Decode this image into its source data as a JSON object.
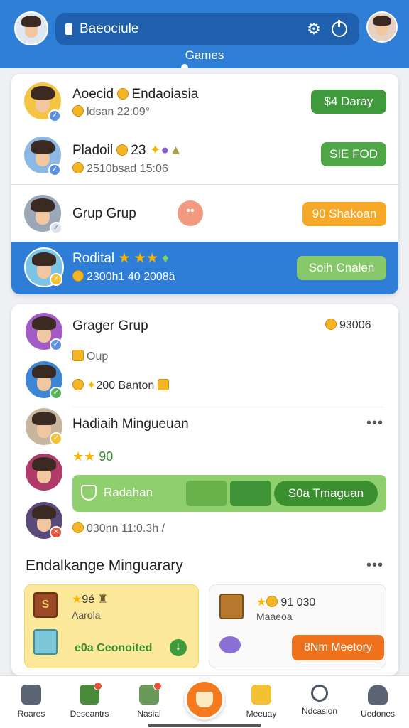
{
  "header": {
    "search_text": "Baeociule",
    "tab_label": "Games"
  },
  "card1": {
    "rows": [
      {
        "name": "Aoecid",
        "name_extra": "Endaoiasia",
        "sub": "ldsan 22:09°",
        "button": "$4 Daray"
      },
      {
        "name": "Pladoil",
        "name_extra": "23",
        "sub": "2510bsad 15:06",
        "button": "SIE FOD"
      },
      {
        "name": "Grup Grup",
        "button": "90 Shakoan",
        "peach": "••"
      },
      {
        "name": "Rodital",
        "sub": "2300h1 40 2008ä",
        "button": "Soih Cnalen"
      }
    ]
  },
  "card2": {
    "group_title": "Grager Grup",
    "group_coins": "93006",
    "row_oup": "Oup",
    "row_batton": "200 Banton",
    "hadiah_title": "Hadiaih Mingueuan",
    "dots": "•••",
    "score": "90",
    "progress_label": "Radahan",
    "progress_button": "S0a Tmaguan",
    "footer_text": "030nn 11:0.3h /",
    "section_title": "Endalkange Minguarary",
    "tile_left": {
      "line1": "9é",
      "line2": "Aarola",
      "line3": "e0a Ceonoited"
    },
    "tile_right": {
      "line1": "91  030",
      "line2": "Maaeoa",
      "cta": "8Nm Meetory"
    }
  },
  "nav": {
    "items": [
      "Roares",
      "Deseantrs",
      "Nasial",
      "Meeuay",
      "Ndcasion",
      "Uedones"
    ]
  },
  "colors": {
    "primary": "#2f7fd6",
    "green": "#3f9a3c",
    "orange": "#f6a928",
    "cta_orange": "#f0711c"
  }
}
